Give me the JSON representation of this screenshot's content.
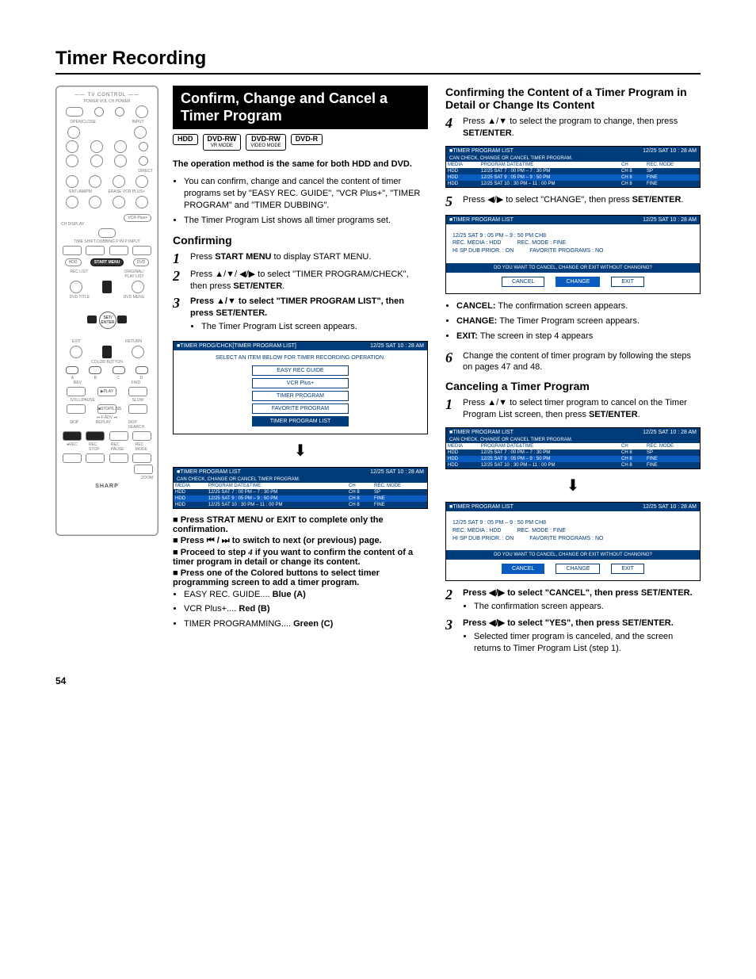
{
  "page_title": "Timer Recording",
  "page_number": "54",
  "section_head": "Confirm, Change and Cancel a Timer Program",
  "tags": [
    {
      "main": "HDD",
      "sub": ""
    },
    {
      "main": "DVD-RW",
      "sub": "VR MODE"
    },
    {
      "main": "DVD-RW",
      "sub": "VIDEO MODE"
    },
    {
      "main": "DVD-R",
      "sub": ""
    }
  ],
  "lead": "The operation method is the same for both HDD and DVD.",
  "intro_bullets": [
    "You can confirm, change and cancel the content of timer programs set by \"EASY REC. GUIDE\", \"VCR Plus+\", \"TIMER PROGRAM\" and \"TIMER DUBBING\".",
    "The Timer Program List shows all timer programs set."
  ],
  "confirming_title": "Confirming",
  "confirming_steps": {
    "s1_a": "Press ",
    "s1_hv": "START MENU",
    "s1_b": " to display START MENU.",
    "s2_a": "Press ",
    "s2_arrows": "▲/▼/ ◀/▶",
    "s2_b": " to select \"TIMER PROGRAM/CHECK\", then press ",
    "s2_hv": "SET/ENTER",
    "s2_c": ".",
    "s3_a": "Press ",
    "s3_arrows": "▲/▼",
    "s3_b": " to select \"TIMER PROGRAM LIST\", then press ",
    "s3_hv": "SET/ENTER",
    "s3_c": ".",
    "s3_sub": "The Timer Program List screen appears."
  },
  "osd_menu": {
    "title_left": "TIMER PROG/CHCK[TIMER PROGRAM LIST]",
    "title_right": "12/25  SAT 10 : 28  AM",
    "prompt": "SELECT AN ITEM BELOW FOR TIMER RECORDING OPERATION.",
    "items": [
      "EASY REC GUIDE",
      "VCR Plus+",
      "TIMER PROGRAM",
      "FAVORITE PROGRAM",
      "TIMER PROGRAM LIST"
    ],
    "selected_idx": 4
  },
  "osd_list": {
    "title_left": "TIMER PROGRAM LIST",
    "title_right": "12/25  SAT 10 : 28  AM",
    "subtitle": "CAN CHECK, CHANGE OR CANCEL TIMER PROGRAM.",
    "cols": [
      "MEDIA",
      "PROGRAM DATE&TIME",
      "CH",
      "REC. MODE"
    ],
    "rows": [
      [
        "HDD",
        "12/25  SAT    7 : 00  PM  –    7 : 30  PM",
        "CH 8",
        "SP"
      ],
      [
        "HDD",
        "12/25  SAT    9 : 05  PM  –    9 : 50  PM",
        "CH 8",
        "FINE"
      ],
      [
        "HDD",
        "12/25  SAT  10 : 30  PM  –  11 : 00  PM",
        "CH 8",
        "FINE"
      ]
    ],
    "highlight_idx": 1
  },
  "post_notes": {
    "n1_a": "Press ",
    "n1_hv1": "STRAT MENU",
    "n1_mid": " or ",
    "n1_hv2": "EXIT",
    "n1_b": " to complete only the confirmation.",
    "n2_a": "Press ",
    "n2_icons": "⏮ / ⏭",
    "n2_b": "  to switch to next (or previous) page.",
    "n3_a": "Proceed to step ",
    "n3_num": "4",
    "n3_b": " if you want to confirm the content of a timer program in detail or change its content.",
    "n4_a": "Press one of the ",
    "n4_hv": "Colored",
    "n4_b": " buttons to select timer programming screen to add a timer program.",
    "n4_items": [
      "EASY REC. GUIDE.... Blue (A)",
      "VCR Plus+.... Red (B)",
      "TIMER PROGRAMMING.... Green (C)"
    ],
    "n4_bold_idx": {
      "0": "Blue (A)",
      "1": "Red (B)",
      "2": "Green (C)"
    }
  },
  "right_title": "Confirming the Content of a Timer Program in Detail or Change Its Content",
  "r_step4": {
    "a": "Press ",
    "arrows": "▲/▼",
    "b": " to select the program to change, then press ",
    "hv": "SET/ENTER",
    "c": "."
  },
  "r_step5": {
    "a": "Press ",
    "arrows": "◀/▶",
    "b": " to select \"CHANGE\", then press ",
    "hv": "SET/ENTER",
    "c": "."
  },
  "osd_detail": {
    "title_left": "TIMER PROGRAM LIST",
    "title_right": "12/25  SAT 10 : 28  AM",
    "line1": "12/25  SAT    9 : 05 PM  –    9 : 50 PM      CH8",
    "line2a": "REC. MEDIA :    HDD",
    "line2b": "REC. MODE : FINE",
    "line3a": "HI SP DUB PRIOR. : ON",
    "line3b": "FAVORITE PROGRAMS : NO",
    "prompt": "DO YOU WANT TO CANCEL, CHANGE OR EXIT WITHOUT CHANGING?",
    "btns": [
      "CANCEL",
      "CHANGE",
      "EXIT"
    ],
    "highlight_idx": 1
  },
  "r_after5": [
    {
      "b": "CANCEL:",
      "t": " The confirmation screen appears."
    },
    {
      "b": "CHANGE:",
      "t": " The Timer Program screen appears."
    },
    {
      "b": "EXIT:",
      "t": " The screen in step 4 appears"
    }
  ],
  "r_step6": "Change the content of timer program by following the steps on pages 47 and 48.",
  "cancel_title": "Canceling a Timer Program",
  "c_step1": {
    "a": "Press ",
    "arrows": "▲/▼",
    "b": " to select timer program to cancel on the Timer Program List screen, then press ",
    "hv": "SET/ENTER",
    "c": "."
  },
  "osd_cancel_detail": {
    "highlight_idx": 0
  },
  "c_step2": {
    "a": "Press ",
    "arrows": "◀/▶",
    "b": " to select \"CANCEL\", then press ",
    "hv": "SET/ENTER",
    "c": ".",
    "sub": "The confirmation screen appears."
  },
  "c_step3": {
    "a": "Press ",
    "arrows": "◀/▶",
    "b": " to select \"YES\", then press ",
    "hv": "SET/ENTER",
    "c": ".",
    "sub": "Selected timer program is canceled, and the screen returns to Timer Program List (step 1)."
  },
  "remote": {
    "tv_control": "—— TV CONTROL ——",
    "labels_top": "POWER  VOL        CH     POWER",
    "open_close": "OPEN/CLOSE",
    "input": "INPUT",
    "direct": "DIRECT",
    "ent_ampm": "ENT./AM/PM",
    "erase": "ERASE VCR PLUS+",
    "vcr_plus": "VCR Plus+",
    "ch_display": "CH DISPLAY",
    "timeshift": "TIME SHIFT  DUBBING   P IN P    INPUT",
    "hdd": "HDD",
    "start_menu": "START MENU",
    "dvd": "DVD",
    "rec_list": "REC LIST",
    "orig_play": "ORIGINAL/\nPLAY LIST",
    "dvd_title": "DVD TITLE",
    "dvd_menu": "DVD MENU",
    "set_enter": "SET/\nENTER",
    "exit": "EXIT",
    "return": "RETURN",
    "color_button": "COLOR BUTTON",
    "rev": "REV",
    "fwd": "FWD",
    "play": "▶PLAY",
    "slow": "SLOW",
    "still_pause": "STILL/PAUSE",
    "stop": "■STOP/L.NS",
    "fadv": "⏮   F.ADV   ⏭",
    "skip": "SKIP",
    "replay": "REPLAY",
    "skip_search": "SKIP\nSEARCH",
    "rec": "●REC",
    "rec_stop": "REC\nSTOP",
    "rec_pause": "REC\nPAUSE",
    "rec_mode": "REC\nMODE",
    "zoom": "ZOOM",
    "brand": "SHARP"
  }
}
